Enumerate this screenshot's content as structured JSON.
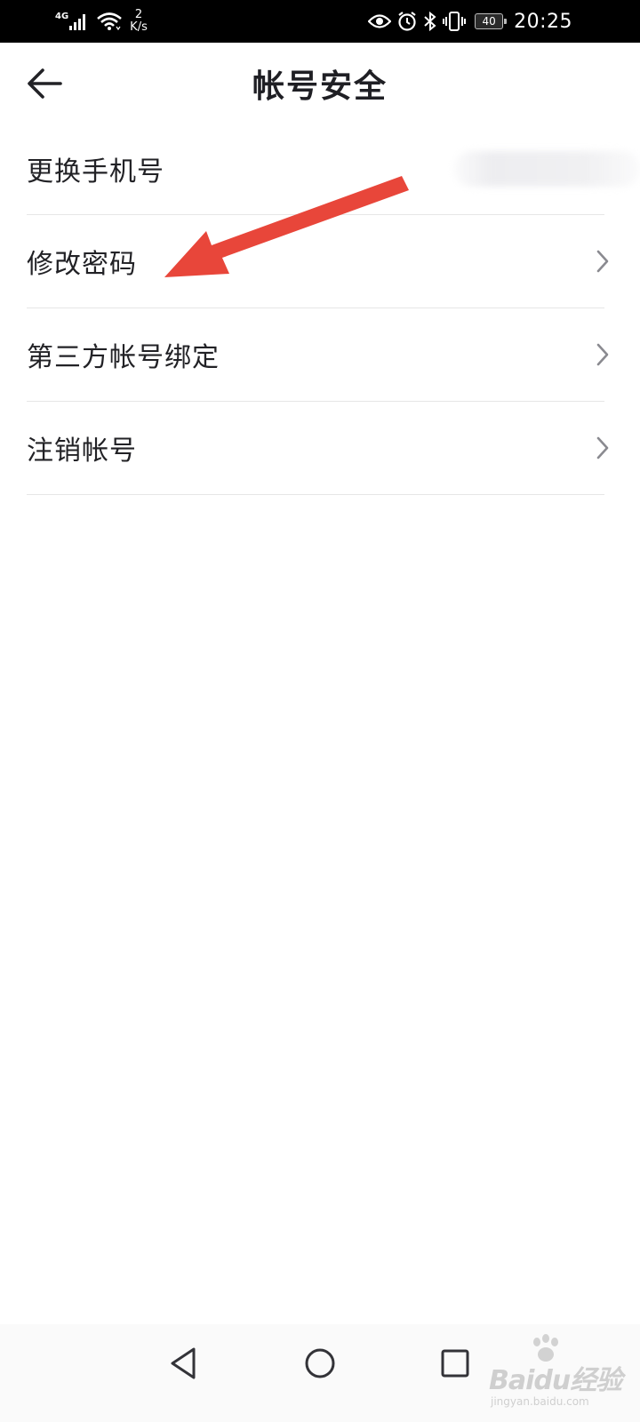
{
  "status_bar": {
    "network_type": "4G",
    "speed_value": "2",
    "speed_unit": "K/s",
    "battery_level": "40",
    "time": "20:25",
    "icons": [
      "signal-icon",
      "wifi-icon",
      "eye-icon",
      "alarm-icon",
      "bluetooth-icon",
      "vibrate-icon",
      "battery-icon"
    ]
  },
  "header": {
    "title": "帐号安全",
    "back_icon": "arrow-left-icon"
  },
  "settings": {
    "items": [
      {
        "label": "更换手机号",
        "has_chevron": false
      },
      {
        "label": "修改密码",
        "has_chevron": true
      },
      {
        "label": "第三方帐号绑定",
        "has_chevron": true
      },
      {
        "label": "注销帐号",
        "has_chevron": true
      }
    ]
  },
  "annotation": {
    "color": "#e8463a",
    "icon": "red-arrow-annotation"
  },
  "nav_bar": {
    "icons": [
      "nav-back-icon",
      "nav-home-icon",
      "nav-recent-icon"
    ]
  },
  "watermark": {
    "logo_text": "Baidu经验",
    "sub_text": "jingyan.baidu.com"
  }
}
